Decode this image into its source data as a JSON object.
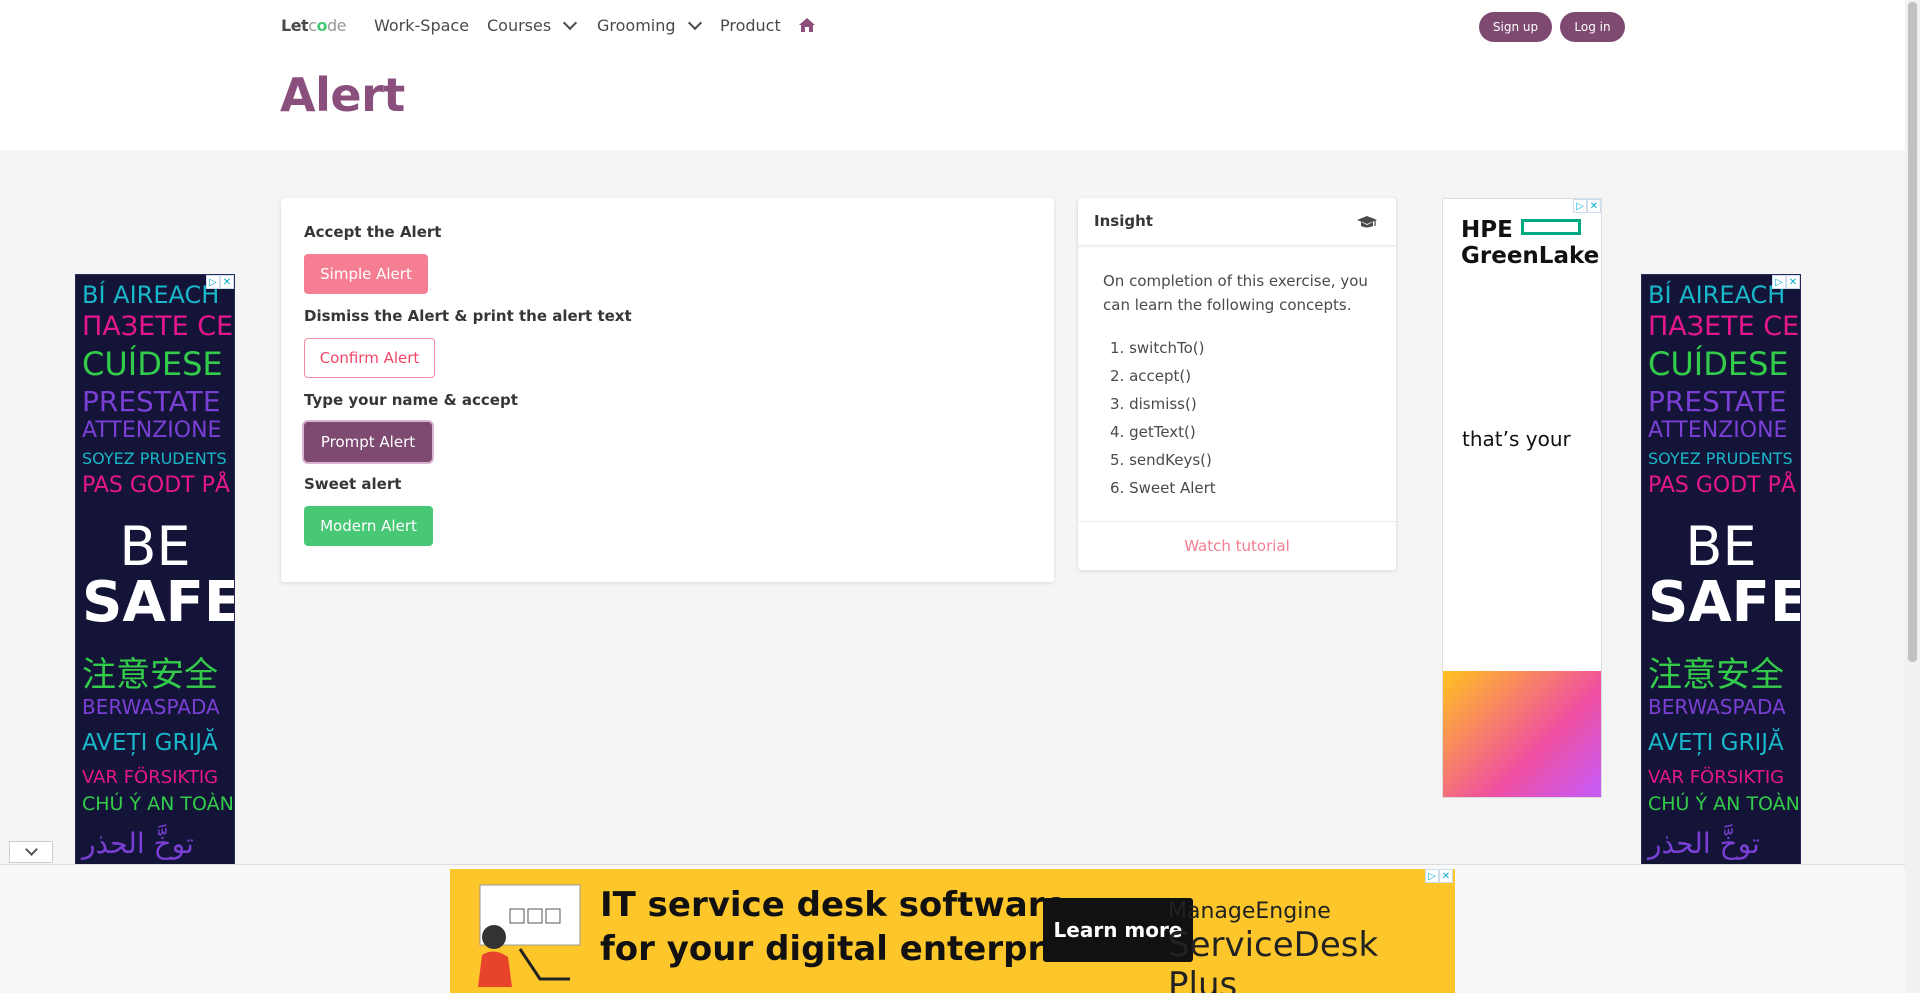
{
  "nav": {
    "brand_let": "Let",
    "brand_c": "c",
    "brand_o": "o",
    "brand_de": "de",
    "items": [
      "Work-Space",
      "Courses",
      "Grooming",
      "Product"
    ],
    "home_icon": "home-icon",
    "signup": "Sign up",
    "login": "Log in"
  },
  "page": {
    "title": "Alert"
  },
  "exercise": {
    "sections": [
      {
        "label": "Accept the Alert",
        "button": "Simple Alert"
      },
      {
        "label": "Dismiss the Alert & print the alert text",
        "button": "Confirm Alert"
      },
      {
        "label": "Type your name & accept",
        "button": "Prompt Alert"
      },
      {
        "label": "Sweet alert",
        "button": "Modern Alert"
      }
    ]
  },
  "insight": {
    "title": "Insight",
    "icon": "graduation-cap-icon",
    "description": "On completion of this exercise, you can learn the following concepts.",
    "concepts": [
      "1. switchTo()",
      "2. accept()",
      "3. dismiss()",
      "4. getText()",
      "5. sendKeys()",
      "6. Sweet Alert"
    ],
    "footer": "Watch tutorial"
  },
  "ads": {
    "safety_lines": [
      "BÍ AIREACH",
      "ПАЗЕТЕ СЕ",
      "CUÍDESE",
      "PRESTATE",
      "ATTENZIONE",
      "SOYEZ PRUDENTS",
      "PAS GODT PÅ",
      "BE",
      "SAFE",
      "注意安全",
      "BERWASPADA",
      "AVEȚI GRIJĂ",
      "VAR FÖRSIKTIG",
      "CHÚ Ý AN TOÀN",
      "توخَّ الحذر"
    ],
    "hpe_logo_1": "HPE",
    "hpe_logo_2": "GreenLake",
    "hpe_text": "that’s your",
    "banner_line1": "IT service desk software",
    "banner_line2": "for your digital enterprise",
    "banner_button": "Learn more",
    "banner_brand1": "ManageEngine",
    "banner_brand2": "ServiceDesk Plus"
  },
  "colors": {
    "brand": "#7e4a71",
    "title": "#8b4f7e",
    "danger": "#f67e92",
    "success": "#48c774"
  }
}
